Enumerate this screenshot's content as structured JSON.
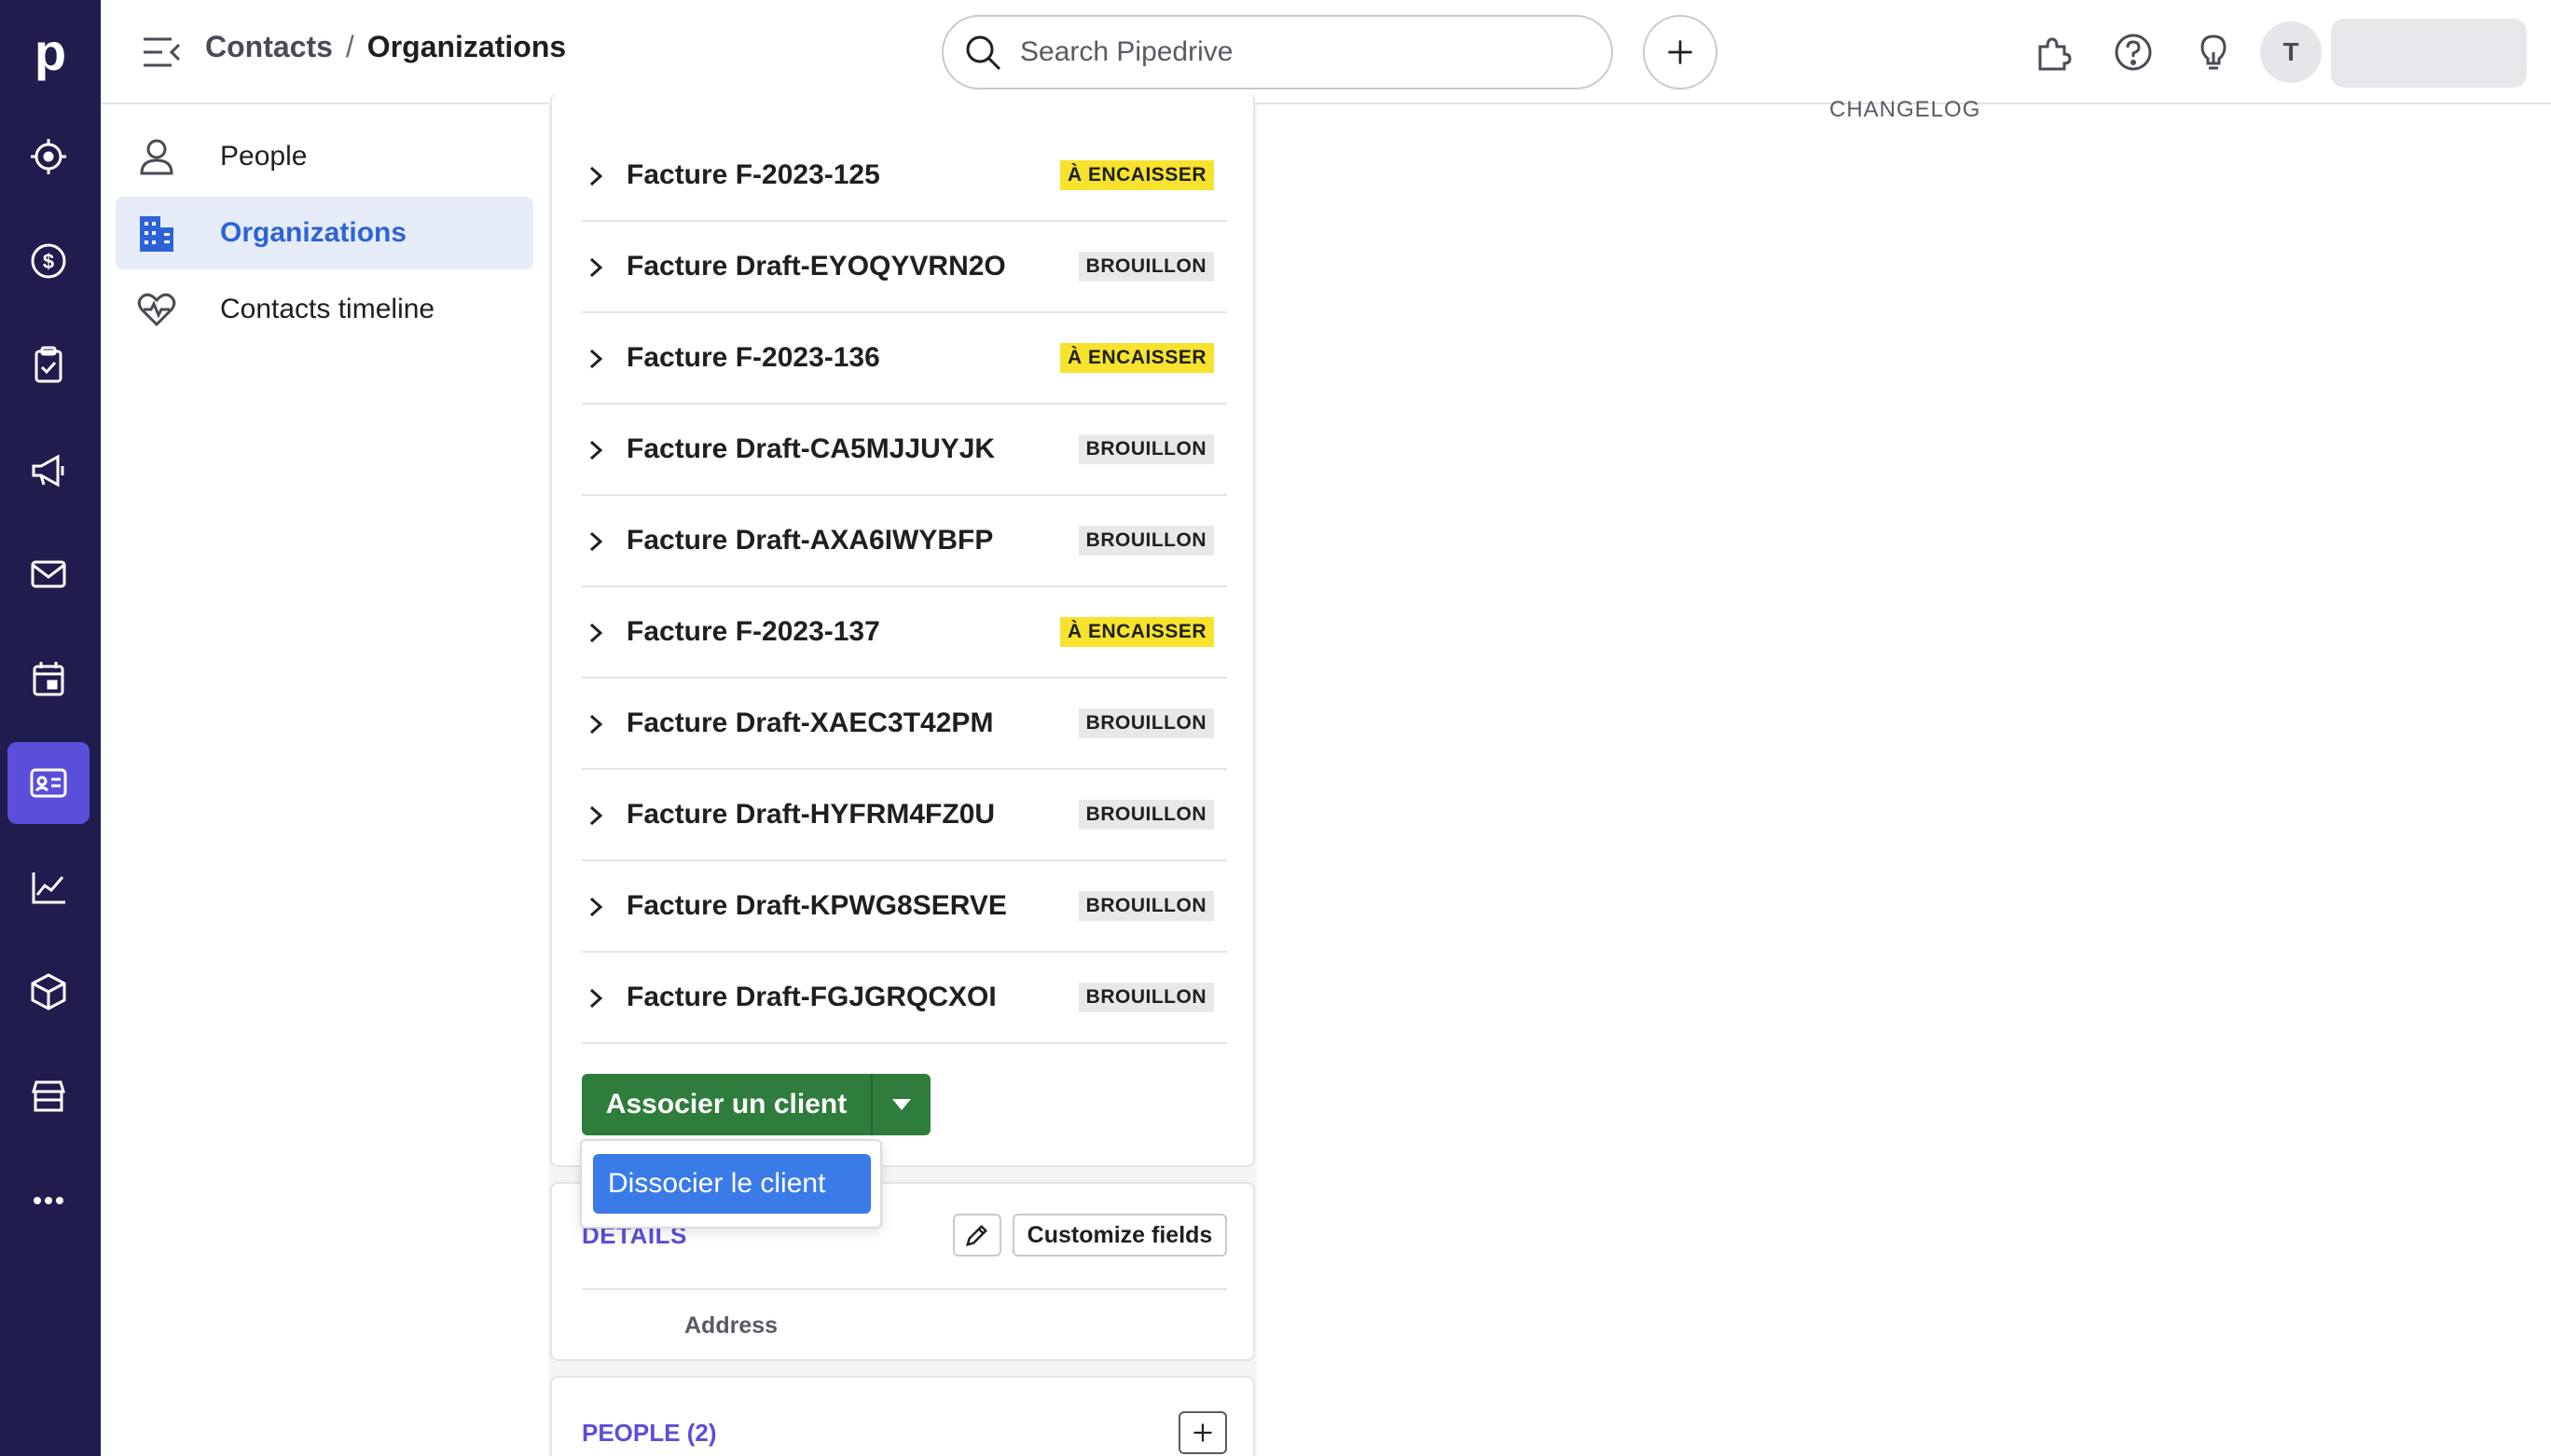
{
  "topbar": {
    "breadcrumb_parent": "Contacts",
    "breadcrumb_separator": "/",
    "breadcrumb_current": "Organizations",
    "search_placeholder": "Search Pipedrive",
    "avatar_initial": "T"
  },
  "rail": {
    "logo": "p",
    "icons": [
      "leads-icon",
      "deals-icon",
      "tasks-icon",
      "campaigns-icon",
      "mail-icon",
      "calendar-icon",
      "contacts-icon",
      "insights-icon",
      "products-icon",
      "marketplace-icon",
      "more-icon"
    ],
    "active": "contacts-icon"
  },
  "subnav": {
    "items": [
      {
        "label": "People",
        "icon": "person-icon"
      },
      {
        "label": "Organizations",
        "icon": "building-icon"
      },
      {
        "label": "Contacts timeline",
        "icon": "heart-pulse-icon"
      }
    ],
    "active_index": 1
  },
  "invoices": [
    {
      "name": "Facture F-2023-125",
      "status": "À ENCAISSER",
      "kind": "due"
    },
    {
      "name": "Facture Draft-EYOQYVRN2O",
      "status": "BROUILLON",
      "kind": "draft"
    },
    {
      "name": "Facture F-2023-136",
      "status": "À ENCAISSER",
      "kind": "due"
    },
    {
      "name": "Facture Draft-CA5MJJUYJK",
      "status": "BROUILLON",
      "kind": "draft"
    },
    {
      "name": "Facture Draft-AXA6IWYBFP",
      "status": "BROUILLON",
      "kind": "draft"
    },
    {
      "name": "Facture F-2023-137",
      "status": "À ENCAISSER",
      "kind": "due"
    },
    {
      "name": "Facture Draft-XAEC3T42PM",
      "status": "BROUILLON",
      "kind": "draft"
    },
    {
      "name": "Facture Draft-HYFRM4FZ0U",
      "status": "BROUILLON",
      "kind": "draft"
    },
    {
      "name": "Facture Draft-KPWG8SERVE",
      "status": "BROUILLON",
      "kind": "draft"
    },
    {
      "name": "Facture Draft-FGJGRQCXOI",
      "status": "BROUILLON",
      "kind": "draft"
    }
  ],
  "actions": {
    "associate_label": "Associer un client",
    "dropdown_item": "Dissocier le client"
  },
  "details": {
    "title": "DETAILS",
    "customize_label": "Customize fields",
    "address_label": "Address"
  },
  "people": {
    "title": "PEOPLE (2)"
  },
  "right_pane": {
    "changelog": "CHANGELOG"
  },
  "colors": {
    "rail_bg": "#211c4e",
    "rail_active": "#5a4fd8",
    "primary_green": "#2f7d3c",
    "link_blue": "#2d63d6",
    "badge_yellow": "#f7e32d",
    "section_purple": "#5a4fd8"
  }
}
